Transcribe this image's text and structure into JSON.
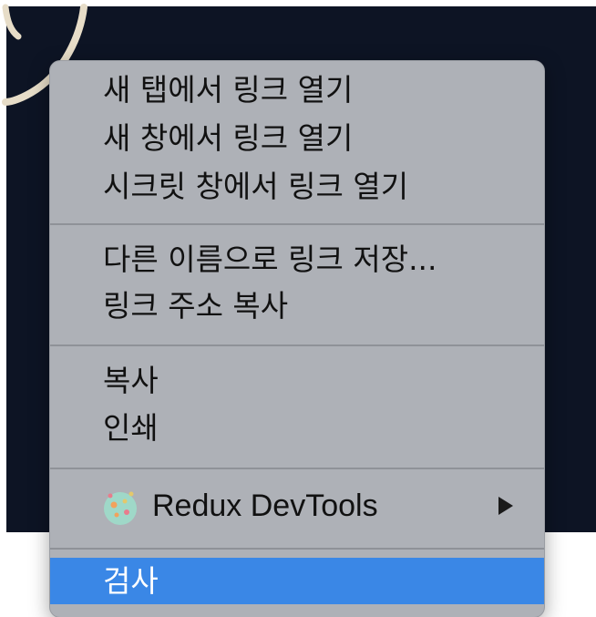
{
  "menu": {
    "groups": [
      {
        "items": [
          {
            "label": "새 탭에서 링크 열기"
          },
          {
            "label": "새 창에서 링크 열기"
          },
          {
            "label": "시크릿 창에서 링크 열기"
          }
        ]
      },
      {
        "items": [
          {
            "label": "다른 이름으로 링크 저장..."
          },
          {
            "label": "링크 주소 복사"
          }
        ]
      },
      {
        "items": [
          {
            "label": "복사"
          },
          {
            "label": "인쇄"
          }
        ]
      },
      {
        "items": [
          {
            "label": "Redux DevTools",
            "icon": "redux-devtools-icon",
            "has_submenu": true
          }
        ]
      },
      {
        "items": [
          {
            "label": "검사",
            "highlighted": true
          }
        ]
      }
    ]
  },
  "colors": {
    "background": "#0d1424",
    "menu_background": "#aeb1b7",
    "highlight": "#3a87e6",
    "separator": "#8f9298"
  }
}
